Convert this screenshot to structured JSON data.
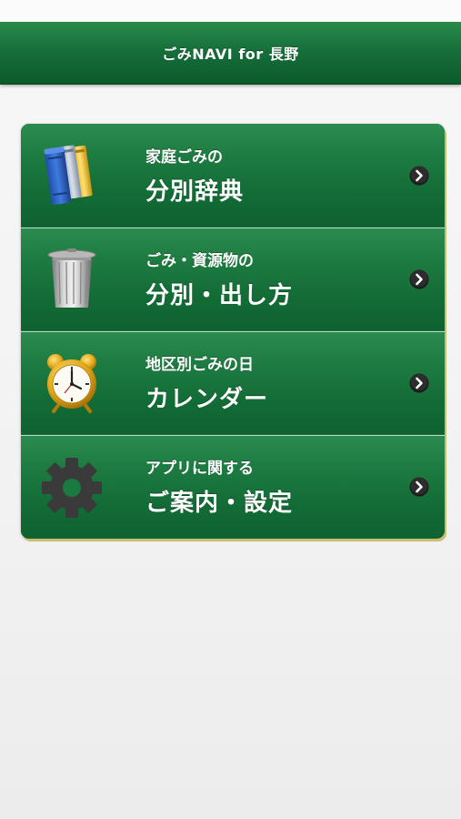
{
  "app": {
    "title": "ごみNAVI for 長野"
  },
  "menu": {
    "items": [
      {
        "sub": "家庭ごみの",
        "main": "分別辞典",
        "icon": "books-icon"
      },
      {
        "sub": "ごみ・資源物の",
        "main": "分別・出し方",
        "icon": "trash-can-icon"
      },
      {
        "sub": "地区別ごみの日",
        "main": "カレンダー",
        "icon": "alarm-clock-icon"
      },
      {
        "sub": "アプリに関する",
        "main": "ご案内・設定",
        "icon": "gear-icon"
      }
    ]
  },
  "colors": {
    "nav_green": "#16703a",
    "row_green": "#1c7a40",
    "card_shadow": "#cbbf72"
  }
}
